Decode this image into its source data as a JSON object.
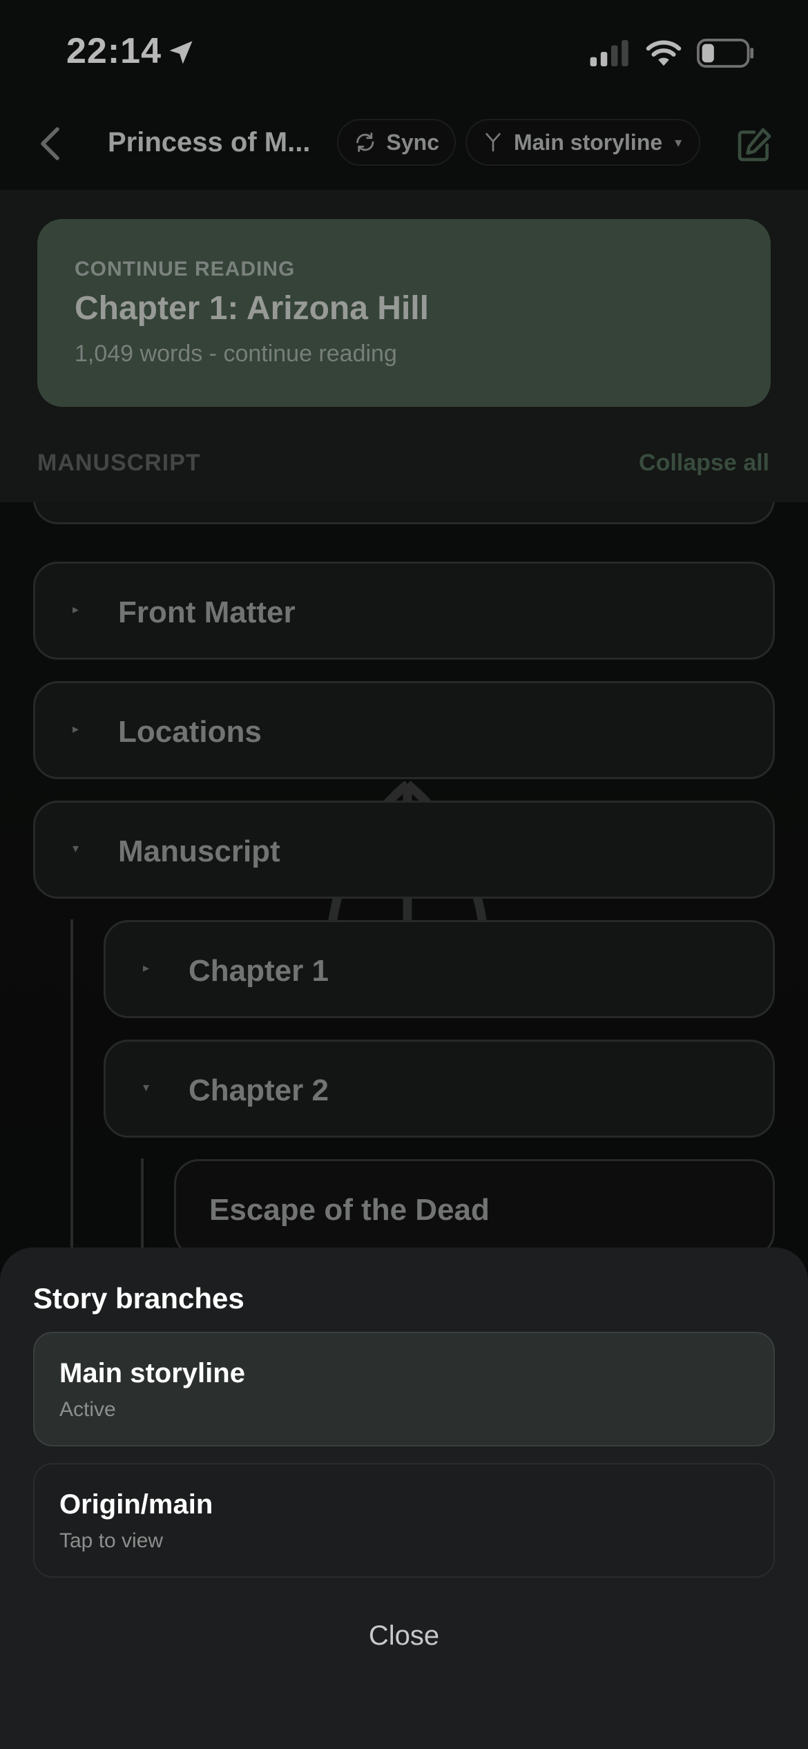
{
  "status_bar": {
    "time": "22:14"
  },
  "header": {
    "title": "Princess of M...",
    "sync_label": "Sync",
    "branch_label": "Main storyline",
    "branch_caret": "▾"
  },
  "continue_reading": {
    "label": "CONTINUE READING",
    "title": "Chapter 1: Arizona Hill",
    "subtitle": "1,049 words - continue reading"
  },
  "manuscript_section": {
    "label": "MANUSCRIPT",
    "collapse_label": "Collapse all"
  },
  "tree": {
    "items": [
      {
        "label": "Front Matter",
        "marker": "▸"
      },
      {
        "label": "Locations",
        "marker": "▸"
      },
      {
        "label": "Manuscript",
        "marker": "▾"
      },
      {
        "label": "Chapter 1",
        "marker": "▸"
      },
      {
        "label": "Chapter 2",
        "marker": "▾"
      },
      {
        "label": "Escape of the Dead"
      }
    ]
  },
  "sheet": {
    "title": "Story branches",
    "branches": [
      {
        "name": "Main storyline",
        "status": "Active"
      },
      {
        "name": "Origin/main",
        "status": "Tap to view"
      }
    ],
    "close_label": "Close"
  },
  "icons": {
    "back": "chevron-left-icon",
    "sync": "sync-icon",
    "branch": "branch-icon",
    "edit": "edit-icon",
    "location": "location-arrow-icon"
  },
  "colors": {
    "accent_card": "#4a5d4e",
    "accent_text": "#4f6a56",
    "sheet_bg": "#1d1e1f"
  }
}
